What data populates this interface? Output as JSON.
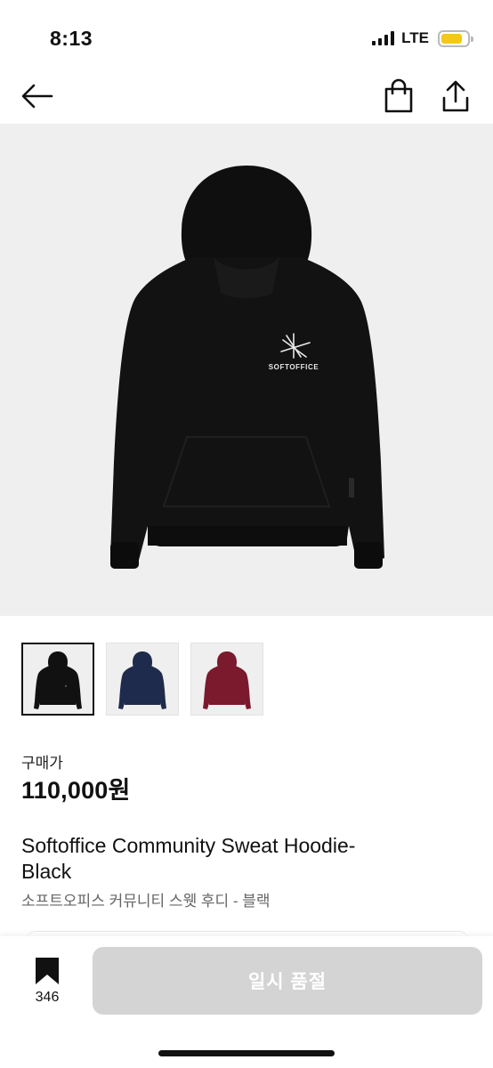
{
  "status_bar": {
    "time": "8:13",
    "network": "LTE",
    "battery_color": "#f3c81a"
  },
  "nav": {
    "back_icon": "arrow-left-icon",
    "bag_icon": "shopping-bag-icon",
    "share_icon": "share-icon"
  },
  "product": {
    "main_image": "black-hoodie-image",
    "logo_text": "SOFTOFFICE",
    "thumbnails": [
      {
        "color_name": "black",
        "color": "#111111",
        "selected": true
      },
      {
        "color_name": "navy",
        "color": "#1f2b4d",
        "selected": false
      },
      {
        "color_name": "burgundy",
        "color": "#7a1a2c",
        "selected": false
      }
    ],
    "price_label": "구매가",
    "price": "110,000원",
    "title": "Softoffice Community Sweat Hoodie- Black",
    "subtitle": "소프트오피스 커뮤니티 스웻 후디 - 블랙"
  },
  "bottom_bar": {
    "bookmark_icon": "bookmark-icon",
    "bookmark_count": "346",
    "buy_button_label": "일시 품절",
    "buy_button_color": "#d4d4d4"
  }
}
